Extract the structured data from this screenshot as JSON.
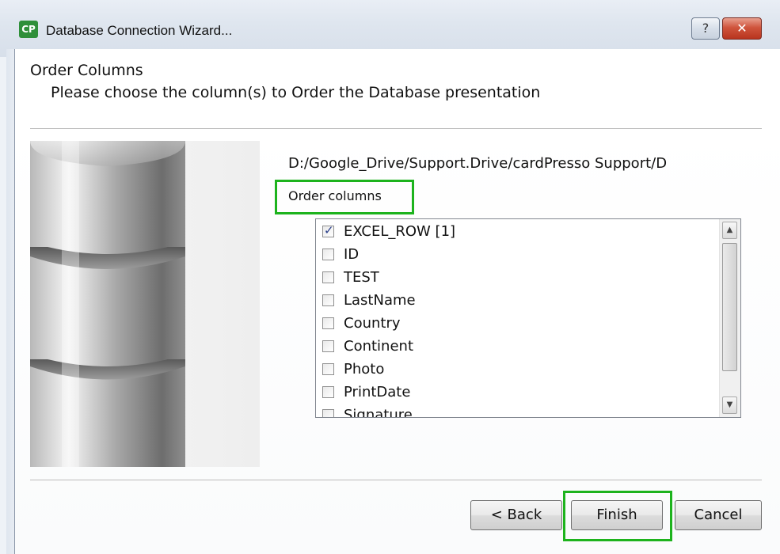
{
  "window": {
    "title": "Database Connection Wizard...",
    "app_icon_text": "CP",
    "help_label": "?",
    "close_label": "✕"
  },
  "page": {
    "heading": "Order Columns",
    "subheading": "Please choose the column(s) to Order the Database presentation"
  },
  "content": {
    "path": "D:/Google_Drive/Support.Drive/cardPresso Support/D",
    "order_label": "Order columns",
    "columns": [
      {
        "label": "EXCEL_ROW [1]",
        "checked": true
      },
      {
        "label": "ID",
        "checked": false
      },
      {
        "label": "TEST",
        "checked": false
      },
      {
        "label": "LastName",
        "checked": false
      },
      {
        "label": "Country",
        "checked": false
      },
      {
        "label": "Continent",
        "checked": false
      },
      {
        "label": "Photo",
        "checked": false
      },
      {
        "label": "PrintDate",
        "checked": false
      },
      {
        "label": "Signature",
        "checked": false
      }
    ]
  },
  "buttons": {
    "back": "< Back",
    "finish": "Finish",
    "cancel": "Cancel"
  },
  "colors": {
    "highlight": "#1db31d",
    "title_icon": "#2f8f3a",
    "close_button": "#c8462f"
  },
  "icons": {
    "app": "cardpresso-app-icon",
    "help": "help-icon",
    "close": "close-icon",
    "scroll_up": "chevron-up-icon",
    "scroll_down": "chevron-down-icon",
    "image": "database-cylinder-image"
  }
}
